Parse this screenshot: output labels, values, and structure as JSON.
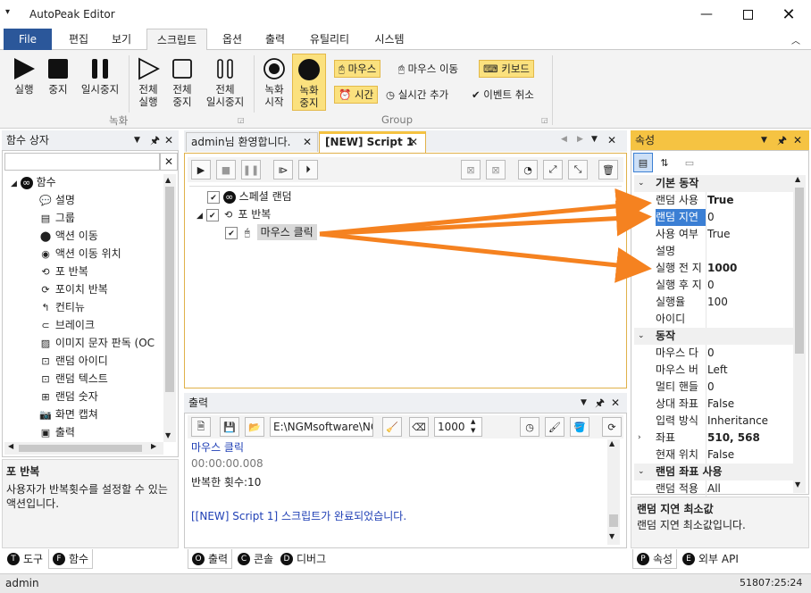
{
  "app": {
    "title": "AutoPeak Editor"
  },
  "ribbon": {
    "tabs": [
      "File",
      "편집",
      "보기",
      "스크립트",
      "옵션",
      "출력",
      "유틸리티",
      "시스템"
    ],
    "buttons": {
      "play": "실행",
      "stop": "중지",
      "pause": "일시중지",
      "play_all_1": "전체",
      "play_all_2": "실행",
      "stop_all_1": "전체",
      "stop_all_2": "중지",
      "pause_all_1": "전체",
      "pause_all_2": "일시중지",
      "rec_start_1": "녹화",
      "rec_start_2": "시작",
      "rec_stop_1": "녹화",
      "rec_stop_2": "중지"
    },
    "group_record": "녹화",
    "group_group": "Group",
    "options": {
      "mouse": "마우스",
      "mouse_move": "마우스 이동",
      "keyboard": "키보드",
      "time": "시간",
      "realtime_add": "실시간 추가",
      "event_cancel": "이벤트 취소"
    }
  },
  "func_panel": {
    "title": "함수 상자",
    "root": "함수",
    "items": [
      "설명",
      "그룹",
      "액션 이동",
      "액션 이동 위치",
      "포 반복",
      "포이치 반복",
      "컨티뉴",
      "브레이크",
      "이미지 문자 판독 (OC",
      "랜덤 아이디",
      "랜덤 텍스트",
      "랜덤 숫자",
      "화면 캡쳐",
      "출력"
    ],
    "desc_title": "포 반복",
    "desc_text_1": "사용자가 반복횟수를 설정할 수 있는",
    "desc_text_2": "액션입니다.",
    "tabs": [
      "도구",
      "함수"
    ]
  },
  "editor": {
    "tabs": [
      "admin님 환영합니다.",
      "[NEW] Script 1"
    ],
    "tree": [
      "스페셜 랜덤",
      "포 반복",
      "마우스 클릭"
    ]
  },
  "output": {
    "title": "출력",
    "path": "E:\\NGMsoftware\\NG",
    "count": "1000",
    "lines": [
      "마우스 클릭",
      "00:00:00.008",
      "반복한 횟수:10",
      "[[NEW] Script 1] 스크립트가 완료되었습니다."
    ],
    "tabs": [
      "출력",
      "콘솔",
      "디버그"
    ]
  },
  "props": {
    "title": "속성",
    "cat_basic": "기본 동작",
    "rows1": [
      {
        "k": "랜덤 사용",
        "v": "True",
        "bold": true
      },
      {
        "k": "랜덤 지연",
        "v": "0",
        "selected": true
      },
      {
        "k": "사용 여부",
        "v": "True"
      },
      {
        "k": "설명",
        "v": ""
      },
      {
        "k": "실행 전 지",
        "v": "1000",
        "bold": true
      },
      {
        "k": "실행 후 지",
        "v": "0"
      },
      {
        "k": "실행율",
        "v": "100"
      },
      {
        "k": "아이디",
        "v": ""
      }
    ],
    "cat_action": "동작",
    "rows2": [
      {
        "k": "마우스 다",
        "v": "0"
      },
      {
        "k": "마우스 버",
        "v": "Left"
      },
      {
        "k": "멀티 핸들",
        "v": "0"
      },
      {
        "k": "상대 좌표",
        "v": "False"
      },
      {
        "k": "입력 방식",
        "v": "Inheritance"
      },
      {
        "k": "좌표",
        "v": "510, 568",
        "bold": true
      },
      {
        "k": "현재 위치",
        "v": "False"
      }
    ],
    "cat_random": "랜덤 좌표 사용",
    "row_last": {
      "k": "랜덤 적용",
      "v": "All"
    },
    "desc_title": "랜덤 지연 최소값",
    "desc_text": "랜덤 지연 최소값입니다.",
    "tabs": [
      "속성",
      "외부 API"
    ]
  },
  "status": {
    "user": "admin",
    "clock": "51807:25:24"
  },
  "colors": {
    "accent": "#2b579a",
    "arrow": "#f58220",
    "highlight": "#fbe17e",
    "selected": "#3b7fd4"
  }
}
